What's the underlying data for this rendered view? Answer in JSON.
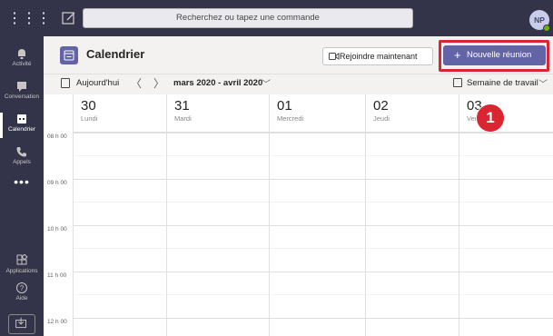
{
  "search": {
    "placeholder": "Recherchez ou tapez une commande"
  },
  "user": {
    "initials": "NP"
  },
  "rail": {
    "items": [
      {
        "label": "Activité",
        "icon": "bell-icon"
      },
      {
        "label": "Conversation",
        "icon": "chat-icon"
      },
      {
        "label": "Calendrier",
        "icon": "calendar-icon"
      },
      {
        "label": "Appels",
        "icon": "phone-icon"
      }
    ],
    "more": "•••",
    "bottom": [
      {
        "label": "Applications",
        "icon": "apps-icon"
      },
      {
        "label": "Aide",
        "icon": "help-icon"
      }
    ]
  },
  "header": {
    "title": "Calendrier",
    "join_label": "Rejoindre maintenant",
    "new_meeting_label": "Nouvelle réunion",
    "plus": "+"
  },
  "toolbar": {
    "today": "Aujourd'hui",
    "prev": "〈",
    "next": "〉",
    "range": "mars 2020 - avril 2020",
    "view": "Semaine de travail"
  },
  "step_badge": "1",
  "days": [
    {
      "num": "30",
      "name": "Lundi"
    },
    {
      "num": "31",
      "name": "Mardi"
    },
    {
      "num": "01",
      "name": "Mercredi"
    },
    {
      "num": "02",
      "name": "Jeudi"
    },
    {
      "num": "03",
      "name": "Vendredi"
    }
  ],
  "times": [
    "08 h 00",
    "09 h 00",
    "10 h 00",
    "11 h 00",
    "12 h 00"
  ],
  "colors": {
    "rail": "#33344a",
    "accent": "#6264a7",
    "highlight": "#d92630"
  }
}
